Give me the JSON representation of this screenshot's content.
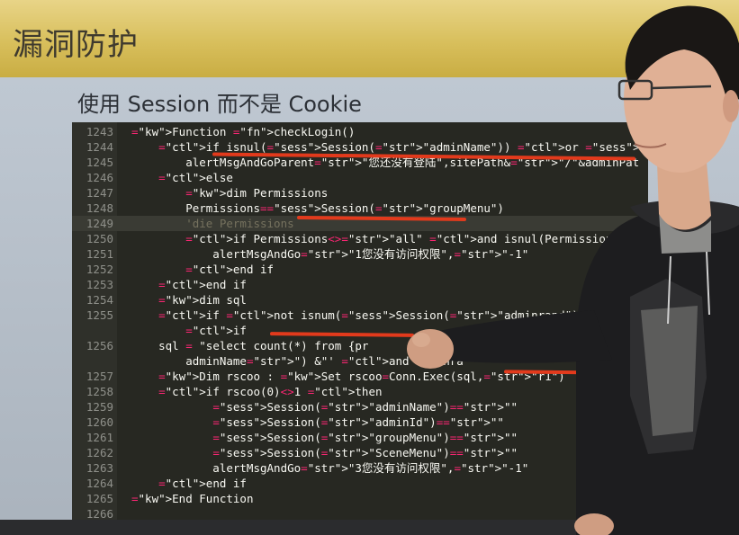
{
  "banner": {
    "title": "漏洞防护"
  },
  "slide": {
    "subtitle": "使用 Session 而不是 Cookie"
  },
  "code": {
    "lines": [
      {
        "n": "1243",
        "t": "Function checkLogin()"
      },
      {
        "n": "1244",
        "t": "    if isnul(Session(\"adminName\")) or Session(\"adminName\")=\""
      },
      {
        "n": "1245",
        "t": "        alertMsgAndGoParent\"您还没有登陆\",sitePath&\"/\"&adminPat"
      },
      {
        "n": "1246",
        "t": "    else"
      },
      {
        "n": "1247",
        "t": "        dim Permissions"
      },
      {
        "n": "1248",
        "t": "        Permissions=Session(\"groupMenu\")"
      },
      {
        "n": "1249",
        "t": "        'die Permissions"
      },
      {
        "n": "1250",
        "t": "        if Permissions<>\"all\" and isnul(Permissions) then"
      },
      {
        "n": "1251",
        "t": "            alertMsgAndGo\"1您没有访问权限\",\"-1\""
      },
      {
        "n": "1252",
        "t": "        end if"
      },
      {
        "n": "1253",
        "t": "    end if"
      },
      {
        "n": "1254",
        "t": "    dim sql"
      },
      {
        "n": "1255",
        "t": "    if not isnum(Session(\"adminrand\")) then alert\""
      },
      {
        "n": "",
        "t": "        if"
      },
      {
        "n": "1256",
        "t": "    sql = \"select count(*) from {pr"
      },
      {
        "n": "",
        "t": "        adminName\") &\"' and adminra                    rand"
      },
      {
        "n": "1257",
        "t": "    Dim rscoo : Set rscoo=Conn.Exec(sql,\"r1\")"
      },
      {
        "n": "1258",
        "t": "    if rscoo(0)<>1 then"
      },
      {
        "n": "1259",
        "t": "            Session(\"adminName\")=\"\""
      },
      {
        "n": "1260",
        "t": "            Session(\"adminId\")=\"\""
      },
      {
        "n": "1261",
        "t": "            Session(\"groupMenu\")=\"\""
      },
      {
        "n": "1262",
        "t": "            Session(\"SceneMenu\")=\"\""
      },
      {
        "n": "1263",
        "t": "            alertMsgAndGo\"3您没有访问权限\",\"-1\""
      },
      {
        "n": "1264",
        "t": "    end if"
      },
      {
        "n": "1265",
        "t": "End Function"
      },
      {
        "n": "1266",
        "t": ""
      }
    ],
    "highlight_index": 6
  },
  "colors": {
    "banner": "#d8bf5c",
    "code_bg": "#272822",
    "keyword": "#66d9ef",
    "control": "#f92672",
    "function": "#a6e22e",
    "pen": "#e23a1c"
  }
}
